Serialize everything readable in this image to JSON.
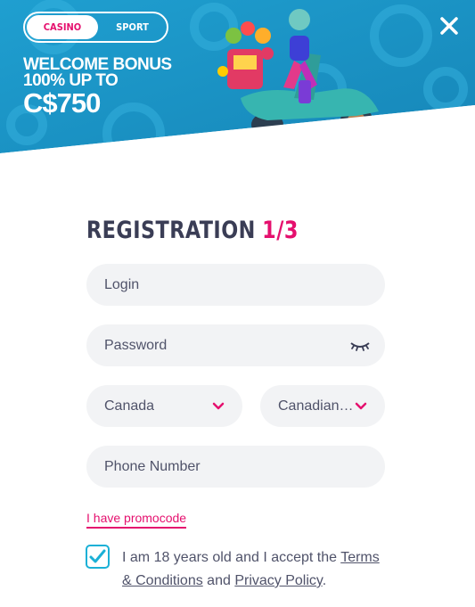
{
  "header": {
    "tabs": [
      {
        "label": "CASINO",
        "active": true
      },
      {
        "label": "SPORT",
        "active": false
      }
    ],
    "welcome": {
      "line1": "WELCOME BONUS",
      "line2": "100% UP TO",
      "line3": "C$750"
    },
    "close_icon": "close-icon"
  },
  "form": {
    "title": "REGISTRATION",
    "step": "1/3",
    "login_placeholder": "Login",
    "password_placeholder": "Password",
    "country_value": "Canada",
    "currency_value": "Canadian…",
    "phone_placeholder": "Phone Number",
    "promocode_link": "I have promocode",
    "terms": {
      "prefix": "I am 18 years old and I accept the ",
      "terms_link": "Terms & Conditions",
      "middle": " and ",
      "privacy_link": "Privacy Policy",
      "suffix": "."
    },
    "accepted": true
  },
  "colors": {
    "accent_pink": "#e5106e",
    "banner_blue": "#1a93c4",
    "checkbox_blue": "#1ab0d6",
    "field_bg": "#f2f3f5"
  }
}
